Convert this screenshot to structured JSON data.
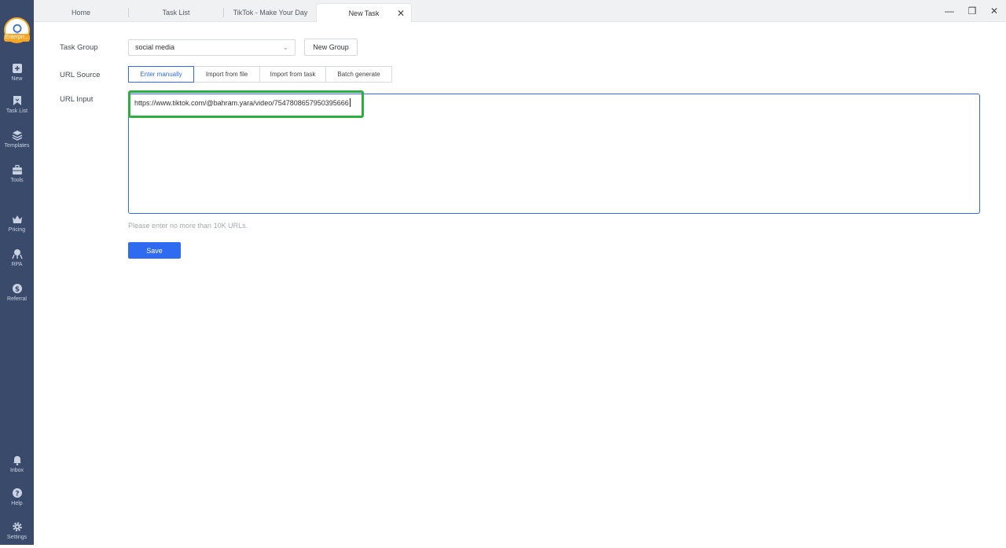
{
  "sidebar": {
    "avatar_badge": "Enterpri...",
    "items": [
      {
        "label": "New",
        "icon": "plus-square-icon"
      },
      {
        "label": "Task List",
        "icon": "bookmark-icon"
      },
      {
        "label": "Templates",
        "icon": "templates-icon"
      },
      {
        "label": "Tools",
        "icon": "toolbox-icon"
      },
      {
        "label": "Pricing",
        "icon": "crown-icon"
      },
      {
        "label": "RPA",
        "icon": "robot-icon"
      },
      {
        "label": "Referral",
        "icon": "dollar-icon"
      },
      {
        "label": "Inbox",
        "icon": "bell-icon"
      },
      {
        "label": "Help",
        "icon": "question-icon"
      },
      {
        "label": "Settings",
        "icon": "gear-icon"
      }
    ]
  },
  "tabs": [
    {
      "label": "Home"
    },
    {
      "label": "Task List"
    },
    {
      "label": "TikTok - Make Your Day"
    },
    {
      "label": "New Task"
    }
  ],
  "window": {
    "minimize": "—",
    "restore": "❐",
    "close": "✕"
  },
  "form": {
    "task_group_label": "Task Group",
    "task_group_value": "social media",
    "new_group_button": "New Group",
    "url_source_label": "URL Source",
    "url_source_options": [
      "Enter manually",
      "Import from file",
      "Import from task",
      "Batch generate"
    ],
    "url_source_selected": "Enter manually",
    "url_input_label": "URL Input",
    "url_input_value": "https://www.tiktok.com/@bahram.yara/video/7547808657950395666",
    "hint": "Please enter no more than 10K URLs.",
    "save_button": "Save"
  },
  "colors": {
    "sidebar": "#3a4a6b",
    "accent": "#2f6bf0",
    "highlight": "#2eae3e",
    "badge": "#f5a623"
  }
}
